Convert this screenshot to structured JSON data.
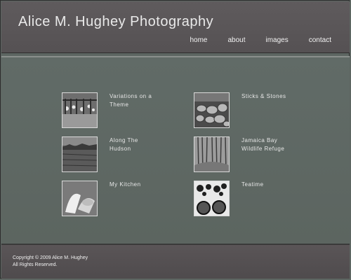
{
  "site": {
    "title": "Alice M. Hughey Photography"
  },
  "nav": [
    {
      "label": "home"
    },
    {
      "label": "about"
    },
    {
      "label": "images"
    },
    {
      "label": "contact"
    }
  ],
  "gallery": [
    {
      "title": "Variations on a Theme"
    },
    {
      "title": "Sticks & Stones"
    },
    {
      "title": "Along The Hudson"
    },
    {
      "title": "Jamaica Bay Wildlife Refuge"
    },
    {
      "title": "My Kitchen"
    },
    {
      "title": "Teatime"
    }
  ],
  "footer": {
    "copyright": "Copyright © 2009 Alice M. Hughey",
    "rights": "All Rights Reserved."
  }
}
